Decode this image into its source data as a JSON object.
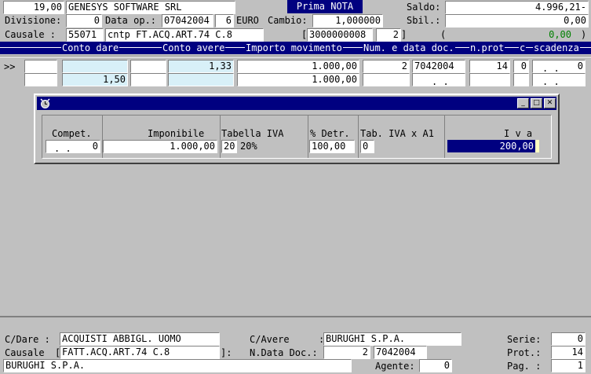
{
  "header": {
    "amount": "19,00",
    "company": "GENESYS SOFTWARE SRL",
    "module_title": "Prima NOTA",
    "saldo_label": "Saldo:",
    "saldo_value": "4.996,21-",
    "divisione_label": "Divisione:",
    "divisione_value": "0",
    "data_op_label": "Data op.:",
    "data_op_value": "07042004",
    "day_value": "6",
    "currency": "EURO",
    "cambio_label": "Cambio:",
    "cambio_value": "1,000000",
    "sbil_label": "Sbil.:",
    "sbil_value": "0,00",
    "causale_label": "Causale  :",
    "causale_code": "55071",
    "causale_desc": "cntp FT.ACQ.ART.74 C.8",
    "ref_open": "[",
    "ref_number": "3000000008",
    "ref_small": "2",
    "ref_close": "]",
    "paren_open": "(",
    "balance_value": "0,00",
    "paren_close": ")"
  },
  "columns": {
    "conto_dare": "Conto dare",
    "conto_avere": "Conto avere",
    "importo": "Importo movimento",
    "num_data_doc": "Num. e data doc.",
    "nprot": "n.prot",
    "c": "c",
    "scadenza": "scadenza"
  },
  "rows": [
    {
      "marker": ">>",
      "code": "",
      "dare": "",
      "mid": "",
      "avere": "1,33",
      "importo": "1.000,00",
      "num": "2",
      "data": "7042004",
      "prot": "14",
      "c": "0",
      "scad_dots": ". .",
      "scad_val": "0"
    },
    {
      "marker": "",
      "code": "",
      "dare": "1,50",
      "mid": "",
      "avere": "",
      "importo": "1.000,00",
      "num": "",
      "data": ". .",
      "prot": "",
      "c": "",
      "scad_dots": ". .",
      "scad_val": ""
    }
  ],
  "dialog": {
    "compet_label": "Compet.",
    "compet_dots": ". .",
    "compet_value": "0",
    "imponibile_label": "Imponibile",
    "imponibile_value": "1.000,00",
    "tabella_label": "Tabella IVA",
    "tabella_code": "20",
    "tabella_desc": "20%",
    "detr_label": "% Detr.",
    "detr_value": "100,00",
    "tab_a1_label": "Tab. IVA x A1",
    "tab_a1_value": "0",
    "iva_label": "I v a",
    "iva_value": "200,00"
  },
  "footer": {
    "cdare_label": "C/Dare  :",
    "cdare_value": "ACQUISTI ABBIGL. UOMO",
    "cavere_label": "C/Avere",
    "cavere_colon": ":",
    "cavere_value": "BURUGHI S.P.A.",
    "serie_label": "Serie:",
    "serie_value": "0",
    "causale_label": "Causale",
    "causale_open": "[",
    "causale_value": "FATT.ACQ.ART.74 C.8",
    "causale_close": "]:",
    "ndata_label": "N.Data Doc.:",
    "ndoc_value": "2",
    "data_doc_value": "7042004",
    "prot_label": "Prot.:",
    "prot_value": "14",
    "supplier": "BURUGHI S.P.A.",
    "agente_label": "Agente:",
    "agente_value": "0",
    "pag_label": "Pag. :",
    "pag_value": "1"
  },
  "colors": {
    "background": "#c0c0c0",
    "title_bar": "#000080",
    "balance_green": "#008000"
  }
}
